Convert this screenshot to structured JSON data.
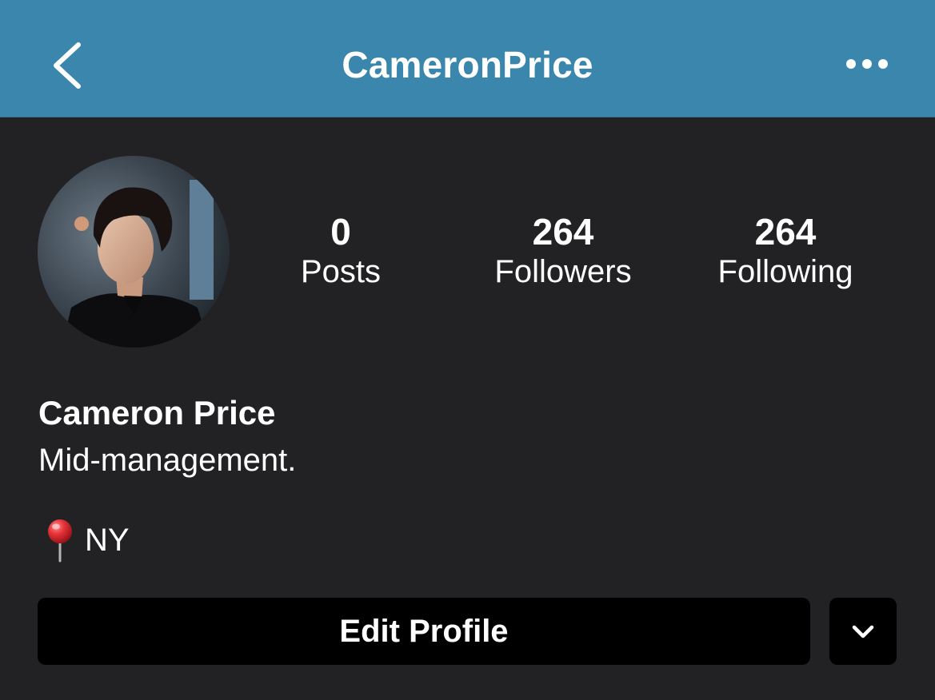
{
  "header": {
    "title": "CameronPrice",
    "back_icon": "chevron-left-icon",
    "more_icon": "more-horizontal-icon",
    "background_color": "#3b86ad"
  },
  "profile": {
    "avatar_icon": "profile-photo",
    "stats": {
      "posts": {
        "value": "0",
        "label": "Posts"
      },
      "followers": {
        "value": "264",
        "label": "Followers"
      },
      "following": {
        "value": "264",
        "label": "Following"
      }
    },
    "name": "Cameron Price",
    "bio": "Mid-management.",
    "location": {
      "icon": "pushpin-icon",
      "text": "NY"
    }
  },
  "actions": {
    "edit_profile_label": "Edit Profile",
    "dropdown_icon": "chevron-down-icon"
  },
  "colors": {
    "background": "#222224",
    "button": "#000000",
    "text": "#ffffff"
  }
}
